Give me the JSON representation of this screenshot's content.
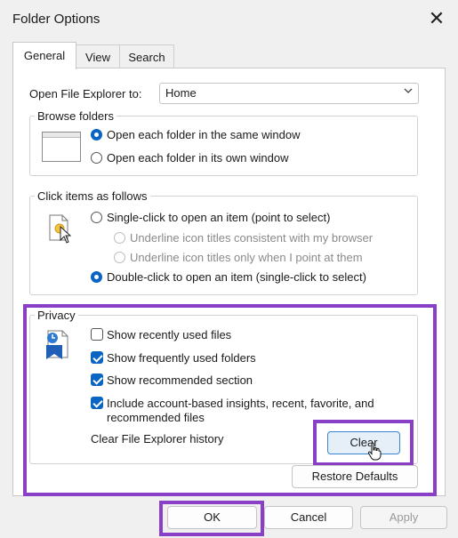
{
  "window": {
    "title": "Folder Options"
  },
  "tabs": [
    {
      "label": "General",
      "active": true
    },
    {
      "label": "View",
      "active": false
    },
    {
      "label": "Search",
      "active": false
    }
  ],
  "open_to": {
    "label": "Open File Explorer to:",
    "value": "Home"
  },
  "browse": {
    "legend": "Browse folders",
    "options": [
      {
        "label": "Open each folder in the same window",
        "selected": true
      },
      {
        "label": "Open each folder in its own window",
        "selected": false
      }
    ]
  },
  "click": {
    "legend": "Click items as follows",
    "single": "Single-click to open an item (point to select)",
    "sub1": "Underline icon titles consistent with my browser",
    "sub2": "Underline icon titles only when I point at them",
    "double": "Double-click to open an item (single-click to select)"
  },
  "privacy": {
    "legend": "Privacy",
    "items": [
      {
        "label": "Show recently used files",
        "checked": false
      },
      {
        "label": "Show frequently used folders",
        "checked": true
      },
      {
        "label": "Show recommended section",
        "checked": true
      },
      {
        "label_line1": "Include account-based insights, recent, favorite, and",
        "label_line2": "recommended files",
        "checked": true
      }
    ],
    "clear_history_label": "Clear File Explorer history",
    "clear_button": "Clear"
  },
  "restore_defaults": "Restore Defaults",
  "footer": {
    "ok": "OK",
    "cancel": "Cancel",
    "apply": "Apply"
  },
  "colors": {
    "accent": "#0a64c2",
    "highlight": "#8a3fc7"
  }
}
